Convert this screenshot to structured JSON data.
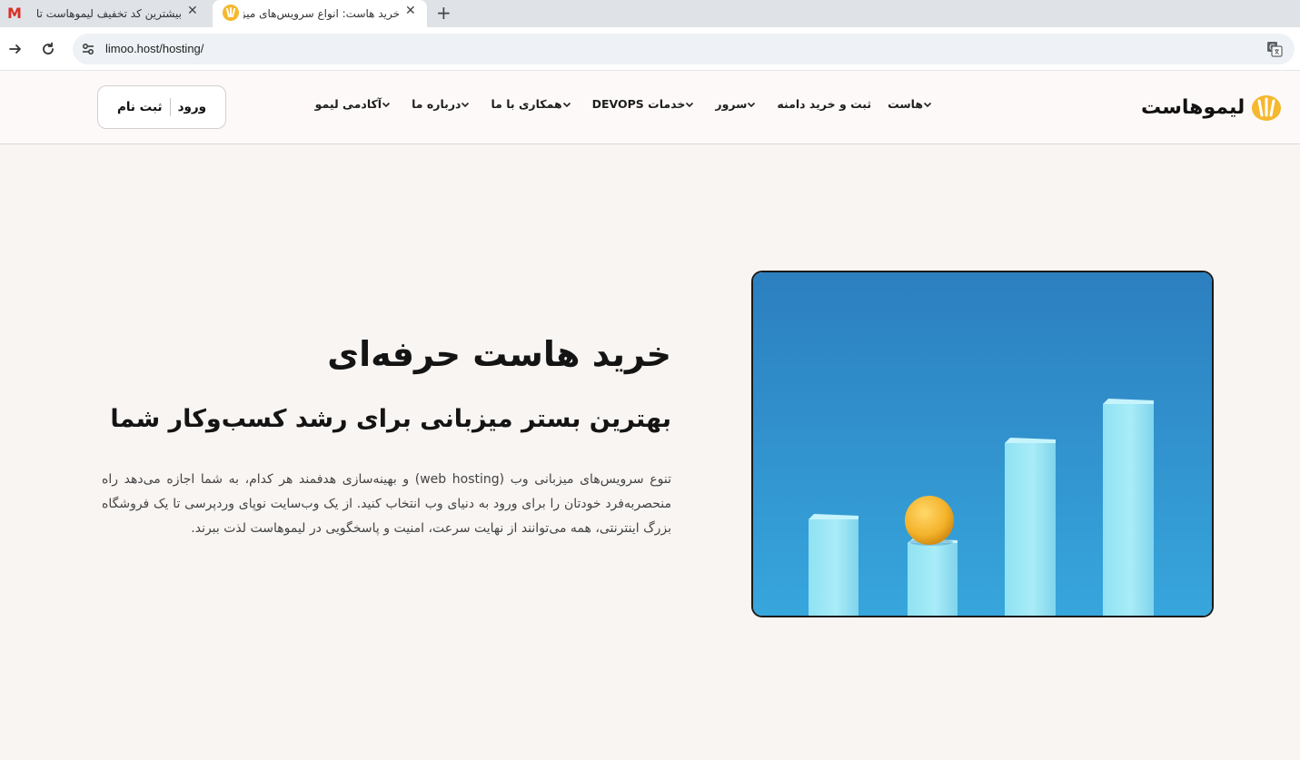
{
  "browser": {
    "tabs": [
      {
        "title": "بیشترین کد تخفیف لیموهاست تا",
        "favicon": "gmail-icon",
        "active": false
      },
      {
        "title": "خرید هاست: انواع سرویس‌های میز",
        "favicon": "limoo-icon",
        "active": true
      }
    ],
    "new_tab": "+",
    "url": "limoo.host/hosting/",
    "close_glyph": "✕"
  },
  "site": {
    "logo_text": "لیموهاست",
    "nav": [
      {
        "label": "هاست"
      },
      {
        "label": "ثبت و خرید دامنه"
      },
      {
        "label": "سرور"
      },
      {
        "label": "خدمات DEVOPS"
      },
      {
        "label": "همکاری با ما"
      },
      {
        "label": "درباره ما"
      },
      {
        "label": "آکادمی لیمو"
      }
    ],
    "login": "ورود",
    "signup": "ثبت نام"
  },
  "hero": {
    "title": "خرید هاست حرفه‌ای",
    "subtitle": "بهترین بستر میزبانی برای رشد کسب‌وکار شما",
    "description": "تنوع سرویس‌های میزبانی وب (web hosting) و بهینه‌سازی هدفمند هر کدام، به شما اجازه می‌دهد راه منحصربه‌فرد خودتان را برای ورود به دنیای وب انتخاب کنید. از یک وب‌سایت نوپای وردپرسی تا یک فروشگاه بزرگ اینترنتی، همه می‌توانند از نهایت سرعت، امنیت و پاسخگویی در لیموهاست لذت ببرند."
  },
  "colors": {
    "accent": "#f5b82e",
    "page_bg": "#f8f5f3",
    "header_bg": "#fdf9f8",
    "image_sky": "#2f8fc9"
  }
}
